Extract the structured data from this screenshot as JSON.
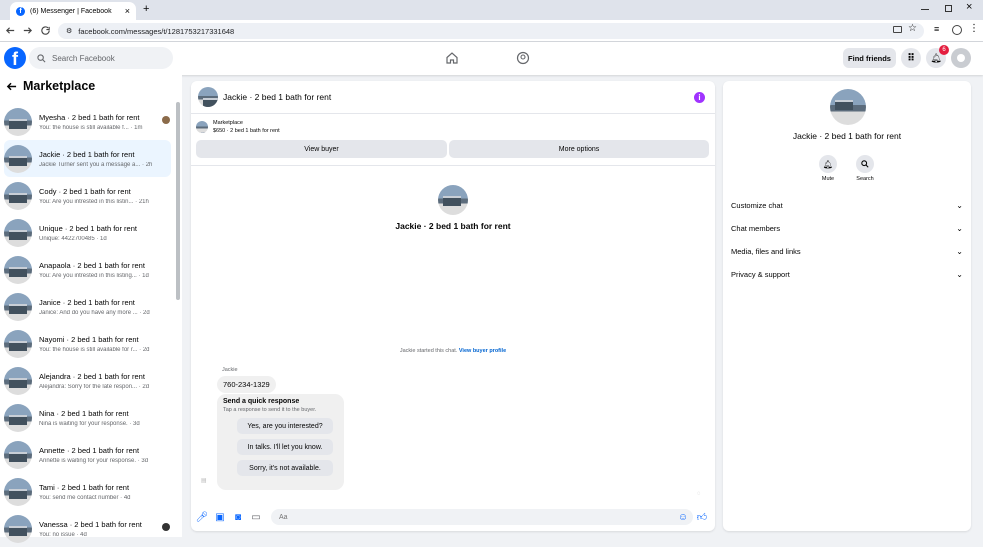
{
  "browser": {
    "tab_title": "(6) Messenger | Facebook",
    "url": "facebook.com/messages/t/1281753217331648",
    "new_tab": "+",
    "close_tab": "×"
  },
  "header": {
    "search_placeholder": "Search Facebook",
    "find_friends": "Find friends",
    "notification_count": "6"
  },
  "sidebar": {
    "title": "Marketplace",
    "conversations": [
      {
        "name": "Myesha · 2 bed 1 bath for rent",
        "preview": "You: the house is still available f... · 1m"
      },
      {
        "name": "Jackie · 2 bed 1 bath for rent",
        "preview": "Jackie Turner sent you a message a... · 2h"
      },
      {
        "name": "Cody · 2 bed 1 bath for rent",
        "preview": "You: Are you intrested in this listin... · 21h"
      },
      {
        "name": "Unique · 2 bed 1 bath for rent",
        "preview": "Unique: 4422700485 · 1d"
      },
      {
        "name": "Anapaola · 2 bed 1 bath for rent",
        "preview": "You: Are you intrested in this listing... · 1d"
      },
      {
        "name": "Janice · 2 bed 1 bath for rent",
        "preview": "Janice: And do you have any more ... · 2d"
      },
      {
        "name": "Nayomi · 2 bed 1 bath for rent",
        "preview": "You: the house is still available for r... · 2d"
      },
      {
        "name": "Alejandra · 2 bed 1 bath for rent",
        "preview": "Alejandra: Sorry for the late respon... · 2d"
      },
      {
        "name": "Nina · 2 bed 1 bath for rent",
        "preview": "Nina is waiting for your response. · 3d"
      },
      {
        "name": "Annette · 2 bed 1 bath for rent",
        "preview": "Annette is waiting for your response. · 3d"
      },
      {
        "name": "Tami · 2 bed 1 bath for rent",
        "preview": "You: send me contact number · 4d"
      },
      {
        "name": "Vanessa · 2 bed 1 bath for rent",
        "preview": "You: no issue · 4d"
      }
    ]
  },
  "chat": {
    "title": "Jackie · 2 bed 1 bath for rent",
    "marketplace_label": "Marketplace",
    "listing": "$650 · 2 bed 1 bath for rent",
    "view_buyer": "View buyer",
    "more_options": "More options",
    "center_title": "Jackie · 2 bed 1 bath for rent",
    "started_text": "Jackie started this chat.",
    "view_buyer_profile": "View buyer profile",
    "sender": "Jackie",
    "phone_message": "760-234-1329",
    "quick_title": "Send a quick response",
    "quick_sub": "Tap a response to send it to the buyer.",
    "quick_options": [
      "Yes, are you interested?",
      "In talks. I'll let you know.",
      "Sorry, it's not available."
    ],
    "input_placeholder": "Aa"
  },
  "details": {
    "name": "Jackie · 2 bed 1 bath for rent",
    "mute": "Mute",
    "search": "Search",
    "sections": [
      "Customize chat",
      "Chat members",
      "Media, files and links",
      "Privacy & support"
    ]
  },
  "colors": {
    "brand": "#0866ff",
    "badge": "#e41e3f",
    "info": "#a033ff"
  }
}
